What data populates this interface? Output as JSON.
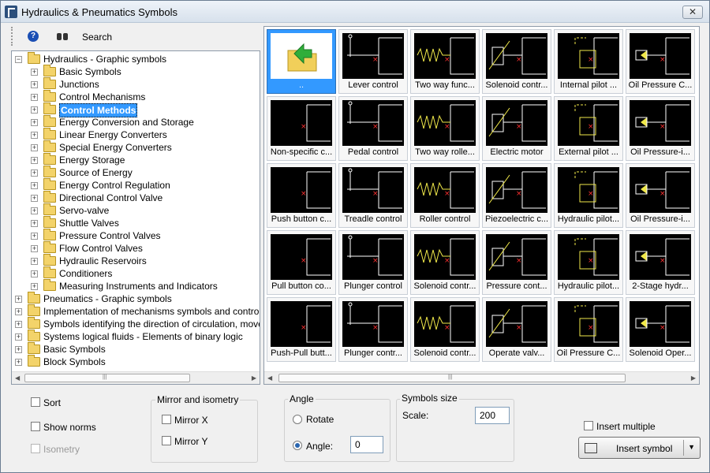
{
  "window": {
    "title": "Hydraulics & Pneumatics Symbols",
    "close_glyph": "✕"
  },
  "toolbar": {
    "help_glyph": "?",
    "search_label": "Search"
  },
  "tree": [
    {
      "label": "Hydraulics - Graphic symbols",
      "level": 0,
      "toggle": "−"
    },
    {
      "label": "Basic Symbols",
      "level": 1,
      "toggle": "+"
    },
    {
      "label": "Junctions",
      "level": 1,
      "toggle": "+"
    },
    {
      "label": "Control Mechanisms",
      "level": 1,
      "toggle": "+"
    },
    {
      "label": "Control Methods",
      "level": 1,
      "toggle": "+",
      "selected": true
    },
    {
      "label": "Energy Conversion and Storage",
      "level": 1,
      "toggle": "+"
    },
    {
      "label": "Linear Energy Converters",
      "level": 1,
      "toggle": "+"
    },
    {
      "label": "Special Energy Converters",
      "level": 1,
      "toggle": "+"
    },
    {
      "label": "Energy Storage",
      "level": 1,
      "toggle": "+"
    },
    {
      "label": "Source of Energy",
      "level": 1,
      "toggle": "+"
    },
    {
      "label": "Energy Control Regulation",
      "level": 1,
      "toggle": "+"
    },
    {
      "label": "Directional Control Valve",
      "level": 1,
      "toggle": "+"
    },
    {
      "label": "Servo-valve",
      "level": 1,
      "toggle": "+"
    },
    {
      "label": "Shuttle Valves",
      "level": 1,
      "toggle": "+"
    },
    {
      "label": "Pressure Control Valves",
      "level": 1,
      "toggle": "+"
    },
    {
      "label": "Flow Control Valves",
      "level": 1,
      "toggle": "+"
    },
    {
      "label": "Hydraulic Reservoirs",
      "level": 1,
      "toggle": "+"
    },
    {
      "label": "Conditioners",
      "level": 1,
      "toggle": "+"
    },
    {
      "label": "Measuring Instruments and Indicators",
      "level": 1,
      "toggle": "+"
    },
    {
      "label": "Pneumatics - Graphic symbols",
      "level": 0,
      "toggle": "+"
    },
    {
      "label": "Implementation of mechanisms symbols and control methods",
      "level": 0,
      "toggle": "+"
    },
    {
      "label": "Symbols identifying the direction of circulation, movement",
      "level": 0,
      "toggle": "+"
    },
    {
      "label": "Systems logical fluids - Elements of binary logic",
      "level": 0,
      "toggle": "+"
    },
    {
      "label": "Basic Symbols",
      "level": 0,
      "toggle": "+"
    },
    {
      "label": "Block Symbols",
      "level": 0,
      "toggle": "+"
    }
  ],
  "symbols": [
    {
      "label": "..",
      "icon": "folder-up-icon"
    },
    {
      "label": "Lever control",
      "icon": "lever-control-icon"
    },
    {
      "label": "Two way func...",
      "icon": "two-way-function-icon"
    },
    {
      "label": "Solenoid contr...",
      "icon": "solenoid-control-icon"
    },
    {
      "label": "Internal pilot ...",
      "icon": "internal-pilot-icon"
    },
    {
      "label": "Oil Pressure C...",
      "icon": "oil-pressure-icon"
    },
    {
      "label": "Non-specific c...",
      "icon": "non-specific-control-icon"
    },
    {
      "label": "Pedal control",
      "icon": "pedal-control-icon"
    },
    {
      "label": "Two way rolle...",
      "icon": "two-way-roller-icon"
    },
    {
      "label": "Electric motor",
      "icon": "electric-motor-icon"
    },
    {
      "label": "External pilot ...",
      "icon": "external-pilot-icon"
    },
    {
      "label": "Oil Pressure-i...",
      "icon": "oil-pressure-increase-icon"
    },
    {
      "label": "Push button c...",
      "icon": "push-button-icon"
    },
    {
      "label": "Treadle control",
      "icon": "treadle-control-icon"
    },
    {
      "label": "Roller control",
      "icon": "roller-control-icon"
    },
    {
      "label": "Piezoelectric c...",
      "icon": "piezoelectric-icon"
    },
    {
      "label": "Hydraulic pilot...",
      "icon": "hydraulic-pilot-icon"
    },
    {
      "label": "Oil Pressure-i...",
      "icon": "oil-pressure-decrease-icon"
    },
    {
      "label": "Pull button co...",
      "icon": "pull-button-icon"
    },
    {
      "label": "Plunger control",
      "icon": "plunger-control-icon"
    },
    {
      "label": "Solenoid contr...",
      "icon": "solenoid-control-2-icon"
    },
    {
      "label": "Pressure cont...",
      "icon": "pressure-control-icon"
    },
    {
      "label": "Hydraulic pilot...",
      "icon": "hydraulic-pilot-2-icon"
    },
    {
      "label": "2-Stage hydr...",
      "icon": "two-stage-hydraulic-icon"
    },
    {
      "label": "Push-Pull butt...",
      "icon": "push-pull-button-icon"
    },
    {
      "label": "Plunger contr...",
      "icon": "plunger-control-2-icon"
    },
    {
      "label": "Solenoid contr...",
      "icon": "solenoid-control-3-icon"
    },
    {
      "label": "Operate valv...",
      "icon": "operate-valve-icon"
    },
    {
      "label": "Oil Pressure C...",
      "icon": "oil-pressure-c-icon"
    },
    {
      "label": "Solenoid Oper...",
      "icon": "solenoid-operated-icon"
    }
  ],
  "options": {
    "sort": "Sort",
    "show_norms": "Show norms",
    "isometry": "Isometry"
  },
  "mirror": {
    "title": "Mirror and isometry",
    "mirror_x": "Mirror X",
    "mirror_y": "Mirror Y"
  },
  "angle": {
    "title": "Angle",
    "rotate": "Rotate",
    "angle": "Angle:",
    "value": "0"
  },
  "size": {
    "title": "Symbols size",
    "scale_label": "Scale:",
    "scale_value": "200"
  },
  "insert": {
    "multiple": "Insert multiple",
    "button": "Insert symbol",
    "arrow": "▼"
  },
  "scroll": {
    "grip": "|||",
    "left": "◀",
    "right": "▶"
  },
  "colors": {
    "selection": "#3399ff",
    "symbol_line": "#ffffff",
    "symbol_accent": "#f0e84a",
    "symbol_marker": "#ff3030"
  }
}
